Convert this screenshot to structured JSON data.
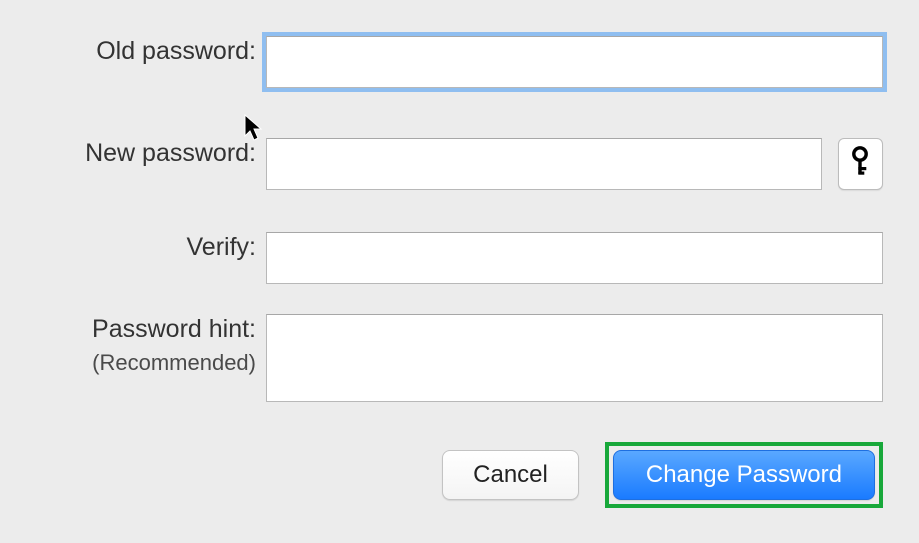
{
  "labels": {
    "old_password": "Old password:",
    "new_password": "New password:",
    "verify": "Verify:",
    "password_hint": "Password hint:",
    "password_hint_sub": "(Recommended)"
  },
  "fields": {
    "old_password_value": "",
    "new_password_value": "",
    "verify_value": "",
    "hint_value": ""
  },
  "buttons": {
    "cancel": "Cancel",
    "change_password": "Change Password"
  },
  "icons": {
    "key": "key-icon",
    "cursor": "cursor-icon"
  },
  "colors": {
    "background": "#ececec",
    "focus_ring": "#8fbef0",
    "primary_button": "#1a7bff",
    "highlight_border": "#18a83a"
  }
}
